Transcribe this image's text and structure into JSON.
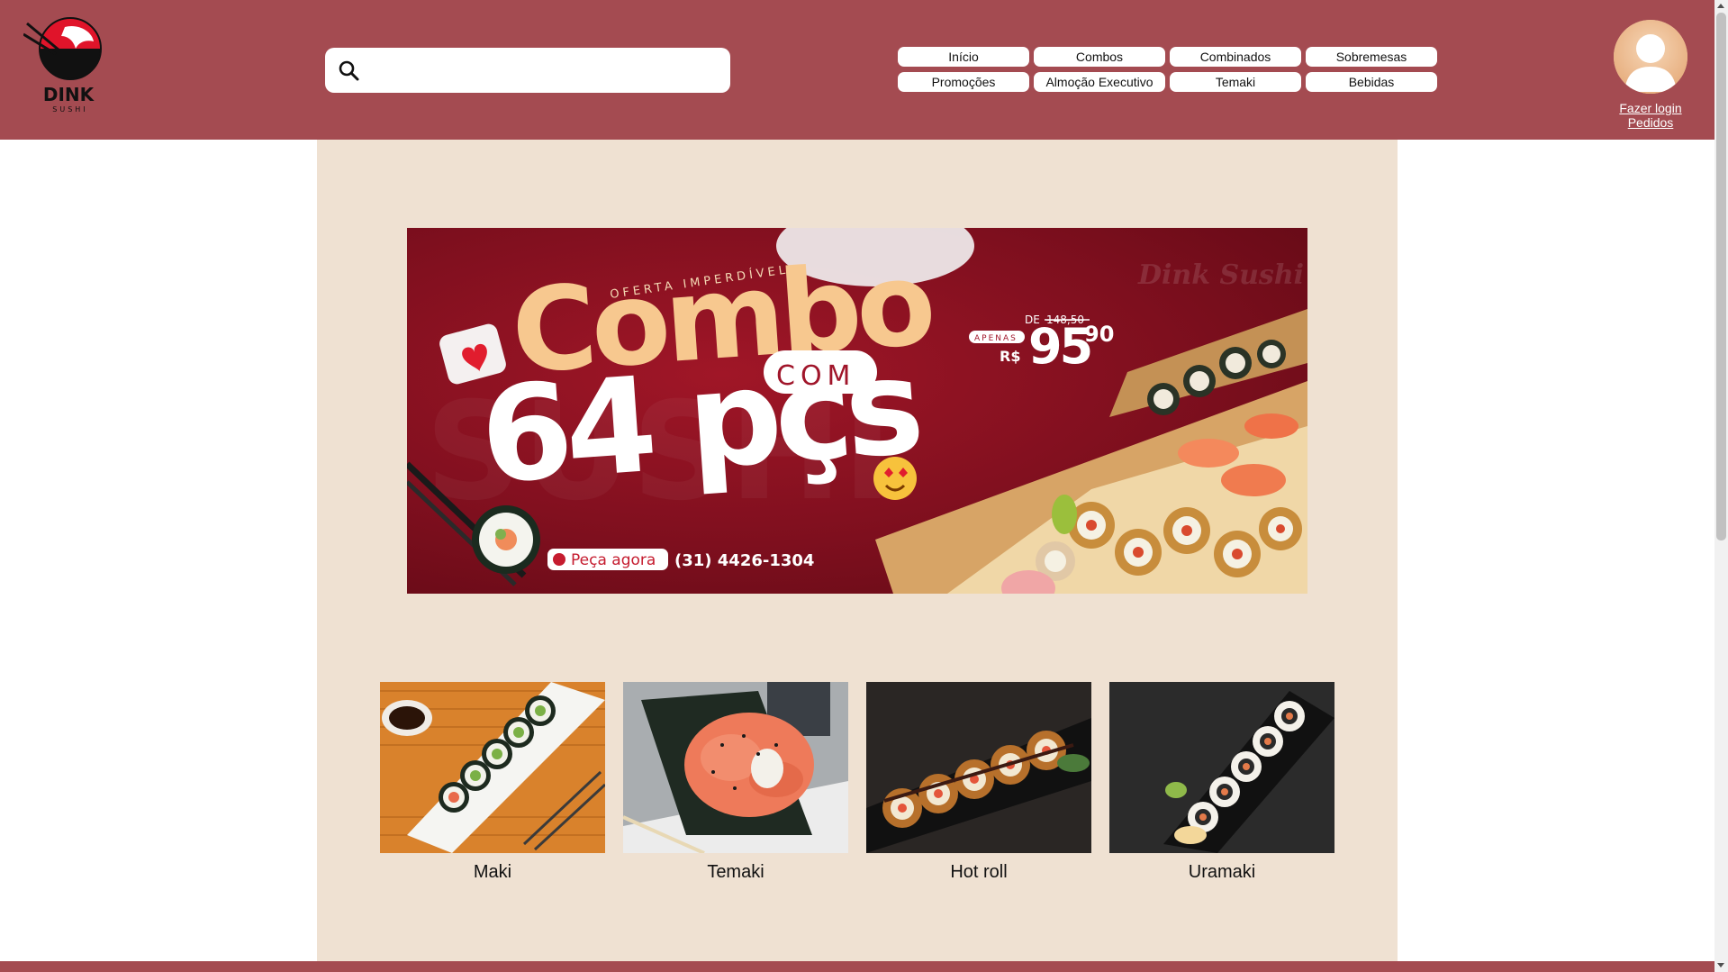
{
  "brand": {
    "name": "DINK",
    "tagline": "SUSHI"
  },
  "search": {
    "placeholder": "",
    "value": ""
  },
  "nav": {
    "items": [
      {
        "label": "Início"
      },
      {
        "label": "Combos"
      },
      {
        "label": "Combinados"
      },
      {
        "label": "Sobremesas"
      },
      {
        "label": "Promoções"
      },
      {
        "label": "Almoção Executivo"
      },
      {
        "label": "Temaki"
      },
      {
        "label": "Bebidas"
      }
    ]
  },
  "user": {
    "login_label": "Fazer login",
    "orders_label": "Pedidos"
  },
  "banner": {
    "kicker": "OFERTA IMPERDÍVEL",
    "headline": "Combo",
    "connector": "COM",
    "count": "64 pçs",
    "price_from_prefix": "DE",
    "price_from": "148,50",
    "price_tag": "APENAS",
    "currency": "R$",
    "price_int": "95",
    "price_dec": "90",
    "brand_script": "Dink Sushi",
    "cta": "Peça agora",
    "phone": "(31) 4426-1304"
  },
  "categories": [
    {
      "label": "Maki"
    },
    {
      "label": "Temaki"
    },
    {
      "label": "Hot roll"
    },
    {
      "label": "Uramaki"
    }
  ],
  "colors": {
    "header": "#a44b51",
    "main_bg": "#efe1d2",
    "banner_red": "#8a1322",
    "banner_cream": "#f7c88f"
  }
}
